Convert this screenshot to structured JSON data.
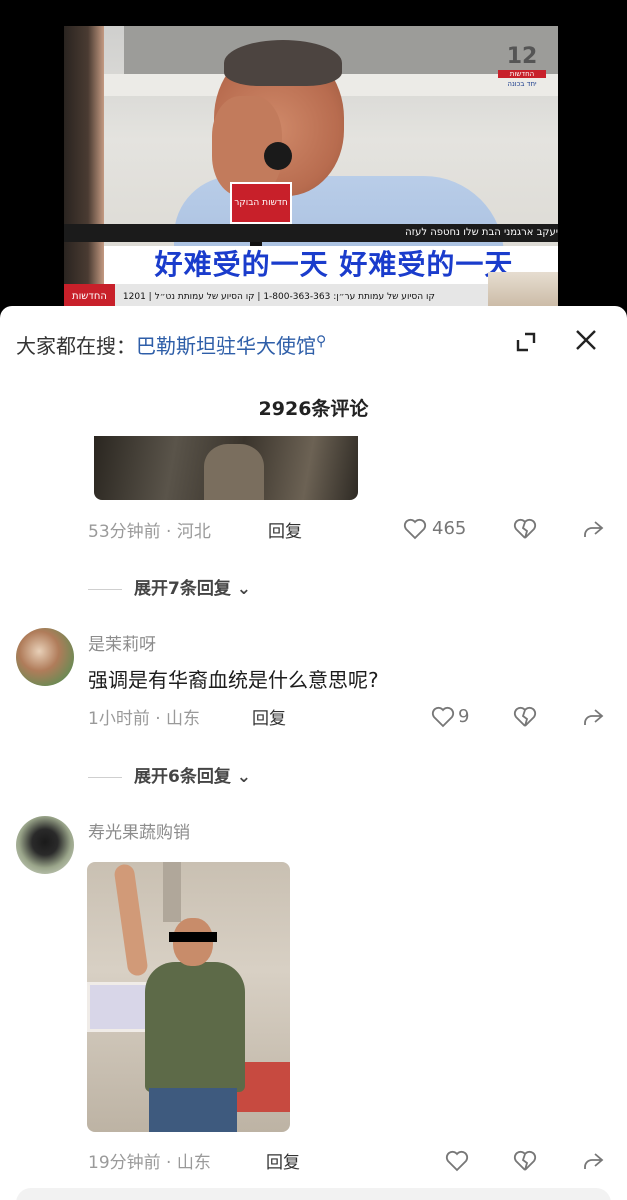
{
  "video": {
    "channel_number": "12",
    "channel_name": "החדשות",
    "channel_tagline": "יחד בכונה",
    "mic_label": "חדשות הבוקר",
    "lower_third": "יעקב ארגמני הבת שלו נחטפה לעזה",
    "subtitle": "好难受的一天 好难受的一天",
    "ticker_tag": "החדשות",
    "ticker_text": "1201 | קו הסיוע של עמותת ער״ן: 1-800-363-363 | קו הסיוע של עמותת נט״ל"
  },
  "sheet": {
    "search_prefix": "大家都在搜：",
    "search_term": "巴勒斯坦驻华大使馆",
    "comment_count": "2926条评论"
  },
  "comments": [
    {
      "time_location": "53分钟前 · 河北",
      "reply_label": "回复",
      "likes": "465"
    },
    {
      "username": "是茉莉呀",
      "text": "强调是有华裔血统是什么意思呢?",
      "time_location": "1小时前 · 山东",
      "reply_label": "回复",
      "likes": "9"
    },
    {
      "username": "寿光果蔬购销",
      "time_location": "19分钟前 · 山东",
      "reply_label": "回复",
      "likes": ""
    }
  ],
  "expanders": [
    {
      "label": "展开7条回复"
    },
    {
      "label": "展开6条回复"
    }
  ],
  "icons": {
    "collapse": "collapse-arrow-icon",
    "close": "close-icon",
    "like": "heart-outline-icon",
    "dislike": "broken-heart-icon",
    "share": "share-arrow-icon",
    "search": "search-icon"
  },
  "colors": {
    "link": "#2e5ea8",
    "subtitle": "#1a3ccc",
    "channel_red": "#c8202a"
  }
}
